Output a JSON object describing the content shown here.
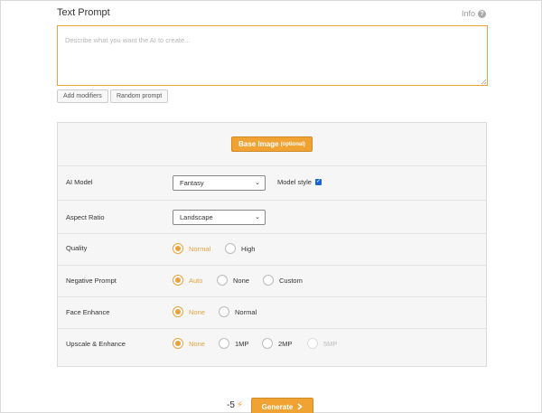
{
  "header": {
    "title": "Text Prompt",
    "info_label": "Info"
  },
  "prompt": {
    "placeholder": "Describe what you want the AI to create...",
    "value": ""
  },
  "helper_buttons": {
    "add_modifiers": "Add modifiers",
    "random_prompt": "Random prompt"
  },
  "panel": {
    "base_image": {
      "label": "Base Image",
      "sub": "(optional)"
    },
    "ai_model": {
      "label": "AI Model",
      "selected": "Fantasy",
      "style_label": "Model style",
      "style_checked": true
    },
    "aspect_ratio": {
      "label": "Aspect Ratio",
      "selected": "Landscape"
    },
    "quality": {
      "label": "Quality",
      "options": [
        "Normal",
        "High"
      ],
      "selected": "Normal"
    },
    "negative_prompt": {
      "label": "Negative Prompt",
      "options": [
        "Auto",
        "None",
        "Custom"
      ],
      "selected": "Auto"
    },
    "face_enhance": {
      "label": "Face Enhance",
      "options": [
        "None",
        "Normal"
      ],
      "selected": "None"
    },
    "upscale": {
      "label": "Upscale & Enhance",
      "options": [
        "None",
        "1MP",
        "2MP",
        "5MP"
      ],
      "selected": "None",
      "disabled": [
        "5MP"
      ]
    }
  },
  "footer": {
    "cost": "-5",
    "generate_label": "Generate"
  },
  "colors": {
    "accent": "#f0a233",
    "checkbox": "#1a66d6"
  },
  "icons": {
    "info": "question-circle-icon",
    "bolt": "lightning-icon",
    "chevron": "chevron-right-icon"
  }
}
